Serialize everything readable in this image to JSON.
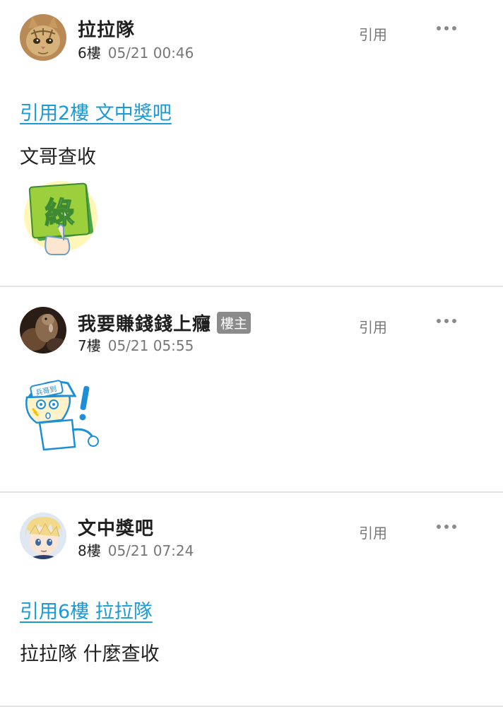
{
  "posts": [
    {
      "author": "拉拉隊",
      "floor": "6樓",
      "time": "05/21 00:46",
      "quote_label": "引用",
      "quote_link": "引用2樓 文中獎吧",
      "text": "文哥查收",
      "sticker": "green-card-sticker",
      "sticker_text": "綠",
      "avatar": "cat-avatar"
    },
    {
      "author": "我要賺錢錢上癮",
      "badge": "樓主",
      "floor": "7樓",
      "time": "05/21 05:55",
      "quote_label": "引用",
      "sticker": "surprised-boy-sticker",
      "sticker_cap_text": "兵哥到",
      "avatar": "animal-photo-avatar"
    },
    {
      "author": "文中獎吧",
      "floor": "8樓",
      "time": "05/21 07:24",
      "quote_label": "引用",
      "quote_link": "引用6樓 拉拉隊",
      "text": "拉拉隊 什麼查收",
      "avatar": "anime-boy-avatar"
    }
  ],
  "colors": {
    "link": "#1a9ad6",
    "badge": "#8b8b8b",
    "divider": "#e3e3e3"
  }
}
